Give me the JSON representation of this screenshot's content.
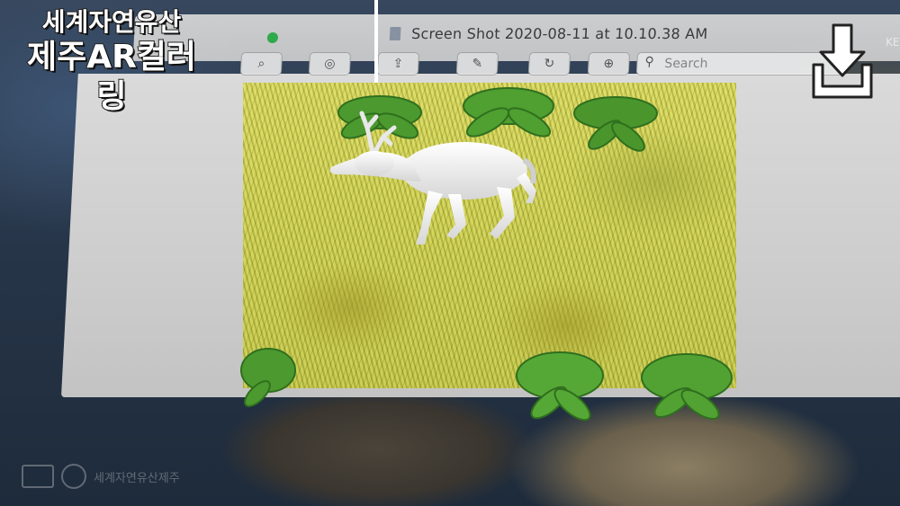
{
  "app": {
    "logo_line1": "세계자연유산",
    "logo_line2": "제주AR컬러링"
  },
  "mac_window": {
    "title": "Screen Shot 2020-08-11 at 10.10.38 AM",
    "search_placeholder": "Search"
  },
  "overlay": {
    "corner_text": "KE",
    "download_icon": "download-icon"
  },
  "watermark": {
    "text": "세계자연유산제주"
  },
  "colors": {
    "grass": "#c9c94e",
    "fern": "#3f8f2a",
    "deer": "#f2f2f2",
    "mac_chrome": "#d6d6d6"
  }
}
